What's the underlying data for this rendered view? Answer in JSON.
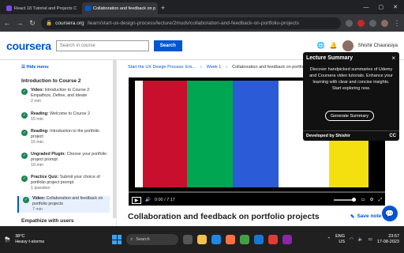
{
  "browser": {
    "tabs": [
      {
        "label": "React 18 Tutorial and Projects C",
        "color": "#7b4cf0"
      },
      {
        "label": "Collaboration and feedback on p",
        "color": "#0056d2"
      }
    ],
    "new_tab": "+",
    "url_host": "coursera.org",
    "url_path": "/learn/start-ux-design-process/lecture/2mudv/collaboration-and-feedback-on-portfolio-projects",
    "profile_name": "Shishir Chaurasiya"
  },
  "header": {
    "logo": "coursera",
    "search_placeholder": "Search in course",
    "search_button": "Search"
  },
  "sidebar": {
    "hide_menu": "Hide menu",
    "section_title": "Introduction to Course 2",
    "items": [
      {
        "type": "Video:",
        "label": "Introduction to Course 2: Empathize, Define, and Ideate",
        "meta": "2 min"
      },
      {
        "type": "Reading:",
        "label": "Welcome to Course 2",
        "meta": "15 min"
      },
      {
        "type": "Reading:",
        "label": "Introduction to the portfolio project",
        "meta": "15 min"
      },
      {
        "type": "Ungraded Plugin:",
        "label": "Choose your portfolio project prompt",
        "meta": "10 min"
      },
      {
        "type": "Practice Quiz:",
        "label": "Submit your choice of portfolio project prompt",
        "meta": "1 question"
      },
      {
        "type": "Video:",
        "label": "Collaboration and feedback on portfolio projects",
        "meta": "7 min"
      }
    ],
    "next_section": "Empathize with users"
  },
  "main": {
    "breadcrumb": [
      "Start the UX Design Process: Em...",
      "Week 1",
      "Collaboration and feedback on portfolio projects"
    ],
    "video_time": "0:00 / 7:17",
    "title": "Collaboration and feedback on portfolio projects",
    "save_note": "Save note",
    "color_bars": [
      "#ffffff",
      "#c8102e",
      "#00a651",
      "#2b5bd7",
      "#f5e00f",
      "#ffffff"
    ]
  },
  "popup": {
    "title": "Lecture Summary",
    "description": "Discover handpicked summaries of Udemy and Coursera video tutorials. Enhance your learning with clear and concise insights. Start exploring now.",
    "button": "Generate Summary",
    "footer": "Developed by Shishir",
    "cc": "CC"
  },
  "taskbar": {
    "temp": "38°C",
    "weather": "Heavy t-storms",
    "search": "Search",
    "lang": "ENG",
    "region": "US",
    "time": "23:57",
    "date": "17-08-2023"
  }
}
